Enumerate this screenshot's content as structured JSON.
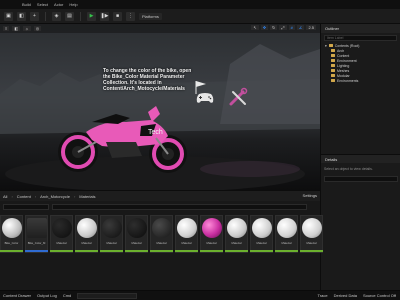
{
  "menubar": {
    "items": [
      "Build",
      "Select",
      "Actor",
      "Help"
    ]
  },
  "toolbar": {
    "platforms_label": "Platforms"
  },
  "viewport": {
    "note_text": "To change the color of the bike, open the Bike_Color Material Parameter Collection. It's located in Content/Arch_Motocycle/Materials",
    "right_chip": "2.5"
  },
  "outliner": {
    "title": "Outliner",
    "search_placeholder": "Item Label",
    "rows": [
      "Arch",
      "Content",
      "Environment",
      "Lighting",
      "Meshes",
      "Modular",
      "Environments"
    ],
    "root_label": "Contents (Root)"
  },
  "details": {
    "title": "Details",
    "message": "Select an object to view details."
  },
  "drawer": {
    "crumbs": [
      "All",
      "Content",
      "Arch_Motorcycle",
      "Materials"
    ],
    "settings_label": "Settings",
    "assets": [
      {
        "label": "Bike_Color"
      },
      {
        "label": "Bike_Color_M"
      },
      {
        "label": "Material"
      },
      {
        "label": "Material"
      },
      {
        "label": "Material"
      },
      {
        "label": "Material"
      },
      {
        "label": "Material"
      },
      {
        "label": "Material"
      },
      {
        "label": "Material"
      },
      {
        "label": "Material"
      },
      {
        "label": "Material"
      },
      {
        "label": "Material"
      },
      {
        "label": "Material"
      }
    ]
  },
  "statusbar": {
    "items": [
      "Content Drawer",
      "Output Log",
      "Cmd"
    ],
    "right": [
      "Trace",
      "Derived Data",
      "Source Control Off"
    ]
  }
}
